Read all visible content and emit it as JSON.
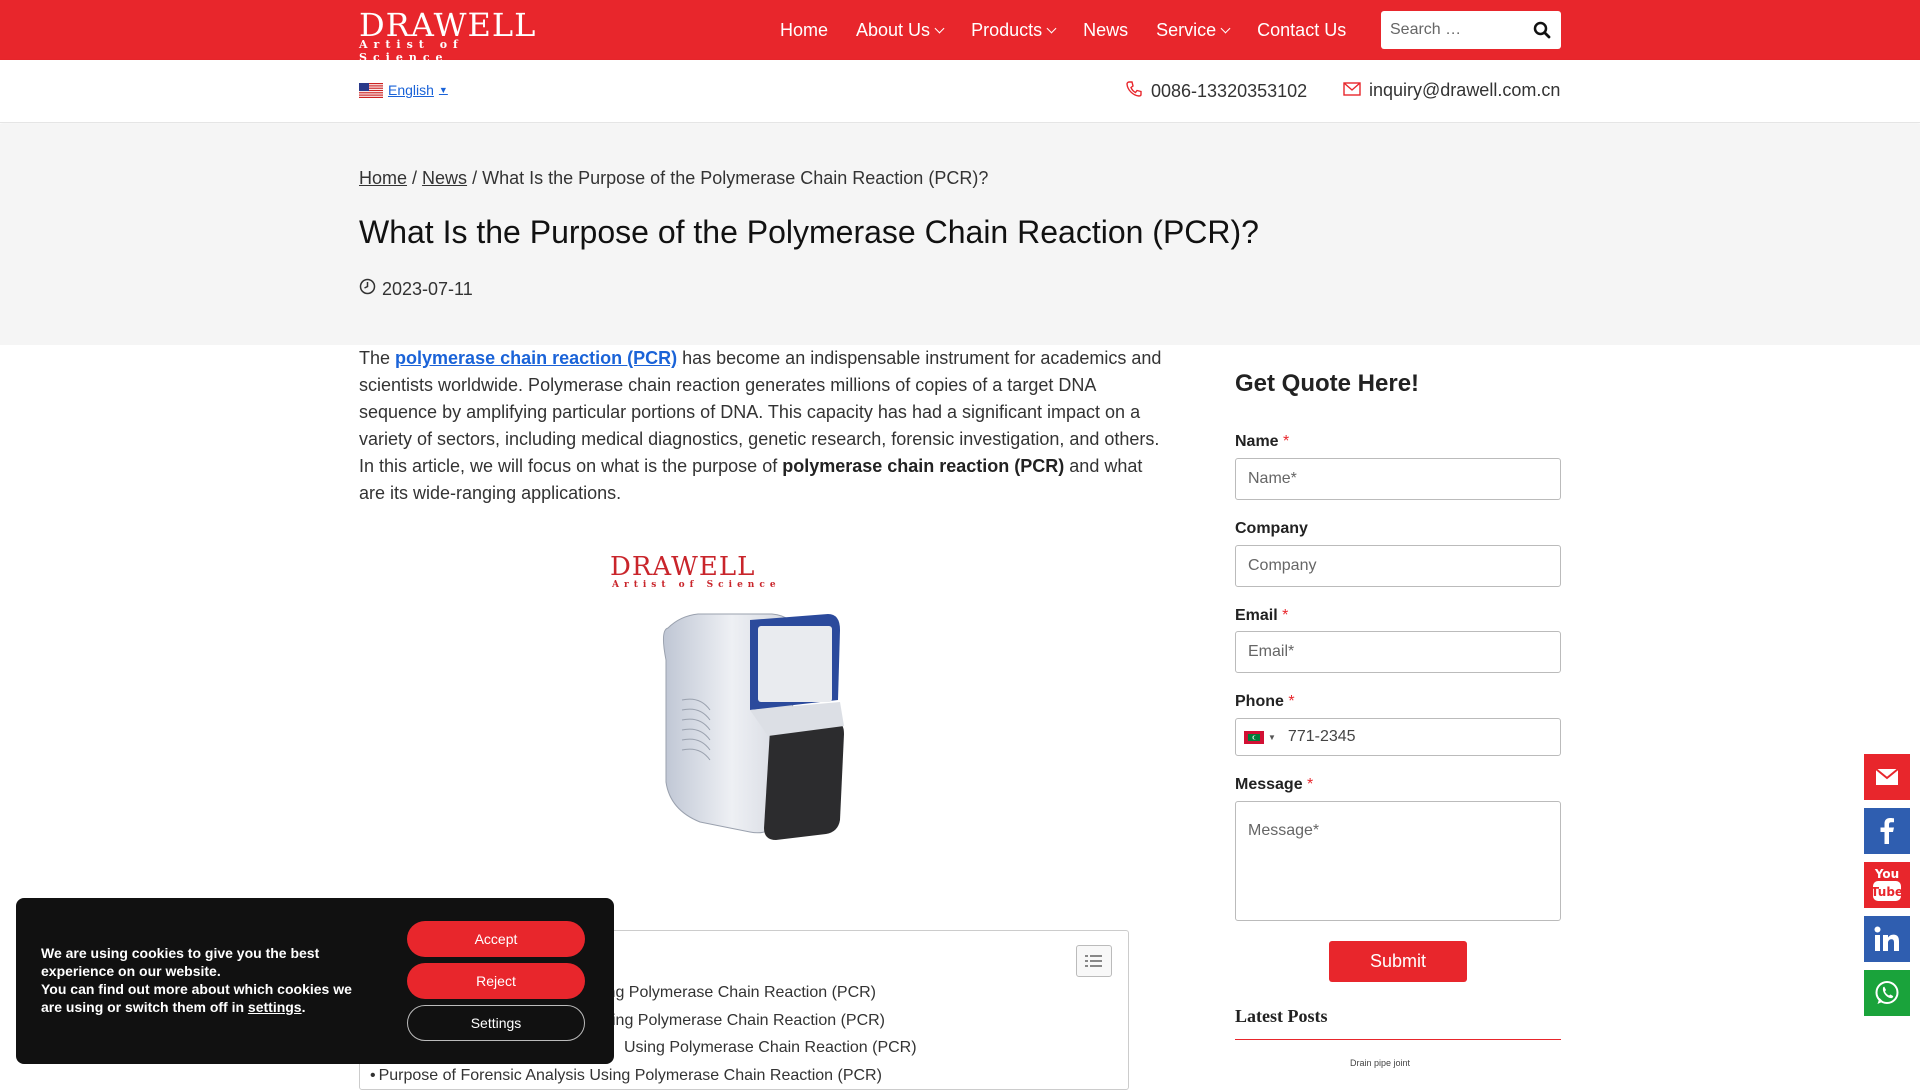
{
  "header": {
    "logo_brand": "DRAWELL",
    "logo_tagline": "Artist of Science",
    "nav": [
      {
        "label": "Home",
        "has_dropdown": false
      },
      {
        "label": "About Us",
        "has_dropdown": true
      },
      {
        "label": "Products",
        "has_dropdown": true
      },
      {
        "label": "News",
        "has_dropdown": false
      },
      {
        "label": "Service",
        "has_dropdown": true
      },
      {
        "label": "Contact Us",
        "has_dropdown": false
      }
    ],
    "search_placeholder": "Search …",
    "accent_color": "#e8262c"
  },
  "subbar": {
    "language": "English",
    "phone": "0086-13320353102",
    "email": "inquiry@drawell.com.cn"
  },
  "breadcrumb": {
    "home": "Home",
    "news": "News",
    "current": "What Is the Purpose of the Polymerase Chain Reaction (PCR)?"
  },
  "article": {
    "title": "What Is the Purpose of the Polymerase Chain Reaction (PCR)?",
    "date": "2023-07-11",
    "intro_pre": "The ",
    "intro_link": "polymerase chain reaction (PCR)",
    "intro_mid": " has become an indispensable instrument for academics and scientists worldwide. Polymerase chain reaction generates millions of copies of a target DNA sequence by amplifying particular portions of DNA. This capacity has had a significant impact on a variety of sectors, including medical diagnostics, genetic research, forensic investigation, and others. In this article, we will focus on what is the purpose of ",
    "intro_bold": "polymerase chain reaction (PCR)",
    "intro_post": " and what are its wide-ranging applications.",
    "image_brand": "DRAWELL",
    "image_tagline": "Artist of Science",
    "toc": [
      "ing Polymerase Chain Reaction (PCR)",
      "sing Polymerase Chain Reaction (PCR)",
      "Using Polymerase Chain Reaction (PCR)",
      "Purpose of Forensic Analysis Using Polymerase Chain Reaction (PCR)"
    ]
  },
  "form": {
    "heading": "Get Quote Here!",
    "name_label": "Name",
    "name_placeholder": "Name*",
    "company_label": "Company",
    "company_placeholder": "Company",
    "email_label": "Email",
    "email_placeholder": "Email*",
    "phone_label": "Phone",
    "phone_value": "771-2345",
    "message_label": "Message",
    "message_placeholder": "Message*",
    "required_mark": "*",
    "submit_label": "Submit"
  },
  "latest_posts_heading": "Latest Posts",
  "latest_thumb_text": "Drain pipe joint",
  "social": [
    "email-icon",
    "facebook-icon",
    "youtube-icon",
    "linkedin-icon",
    "whatsapp-icon"
  ],
  "social_colors": {
    "email": "#e8262c",
    "facebook": "#2f5eb0",
    "youtube": "#e8262c",
    "linkedin": "#2f5eb0",
    "whatsapp": "#1aa33b"
  },
  "cookie": {
    "message_line1": "We are using cookies to give you the best experience on our website.",
    "message_line2": "You can find out more about which cookies we are using or switch them off in ",
    "settings_link": "settings",
    "period": ".",
    "accept": "Accept",
    "reject": "Reject",
    "settings": "Settings"
  }
}
